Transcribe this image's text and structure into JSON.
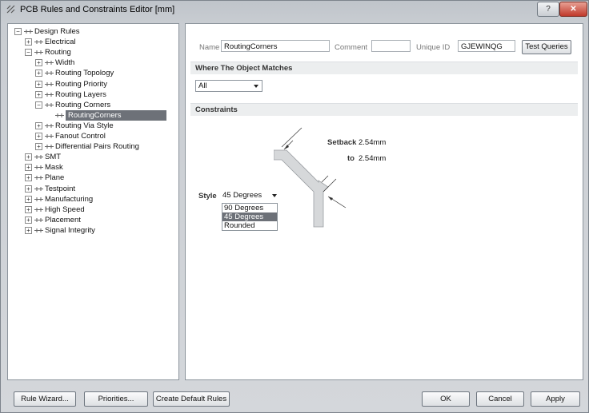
{
  "window": {
    "title": "PCB Rules and Constraints Editor [mm]",
    "help": "?",
    "close": "✕"
  },
  "tree": {
    "root": "Design Rules",
    "items": [
      {
        "label": "Electrical",
        "icon": "electrical-icon"
      },
      {
        "label": "Routing",
        "icon": "routing-icon"
      },
      {
        "label": "Width",
        "icon": "routing-icon"
      },
      {
        "label": "Routing Topology",
        "icon": "routing-icon"
      },
      {
        "label": "Routing Priority",
        "icon": "routing-icon"
      },
      {
        "label": "Routing Layers",
        "icon": "routing-icon"
      },
      {
        "label": "Routing Corners",
        "icon": "routing-icon"
      },
      {
        "label": "RoutingCorners",
        "icon": "routing-icon"
      },
      {
        "label": "Routing Via Style",
        "icon": "routing-icon"
      },
      {
        "label": "Fanout Control",
        "icon": "routing-icon"
      },
      {
        "label": "Differential Pairs Routing",
        "icon": "routing-icon"
      },
      {
        "label": "SMT",
        "icon": "smt-icon"
      },
      {
        "label": "Mask",
        "icon": "mask-icon"
      },
      {
        "label": "Plane",
        "icon": "plane-icon"
      },
      {
        "label": "Testpoint",
        "icon": "testpoint-icon"
      },
      {
        "label": "Manufacturing",
        "icon": "manufacturing-icon"
      },
      {
        "label": "High Speed",
        "icon": "high-speed-icon"
      },
      {
        "label": "Placement",
        "icon": "placement-icon"
      },
      {
        "label": "Signal Integrity",
        "icon": "signal-integrity-icon"
      }
    ]
  },
  "rule": {
    "name_label": "Name",
    "name_value": "RoutingCorners",
    "comment_label": "Comment",
    "comment_value": "",
    "uid_label": "Unique ID",
    "uid_value": "GJEWINQG",
    "test_queries": "Test Queries"
  },
  "match": {
    "heading": "Where The Object Matches",
    "value": "All"
  },
  "constraints": {
    "heading": "Constraints",
    "setback_label": "Setback",
    "setback_value": "2.54mm",
    "to_label": "to",
    "to_value": "2.54mm",
    "style_label": "Style",
    "style_value": "45 Degrees",
    "style_options": [
      "90 Degrees",
      "45 Degrees",
      "Rounded"
    ],
    "selected_option": "45 Degrees"
  },
  "footer": {
    "rule_wizard": "Rule Wizard...",
    "priorities": "Priorities...",
    "create_default": "Create Default Rules",
    "ok": "OK",
    "cancel": "Cancel",
    "apply": "Apply"
  }
}
